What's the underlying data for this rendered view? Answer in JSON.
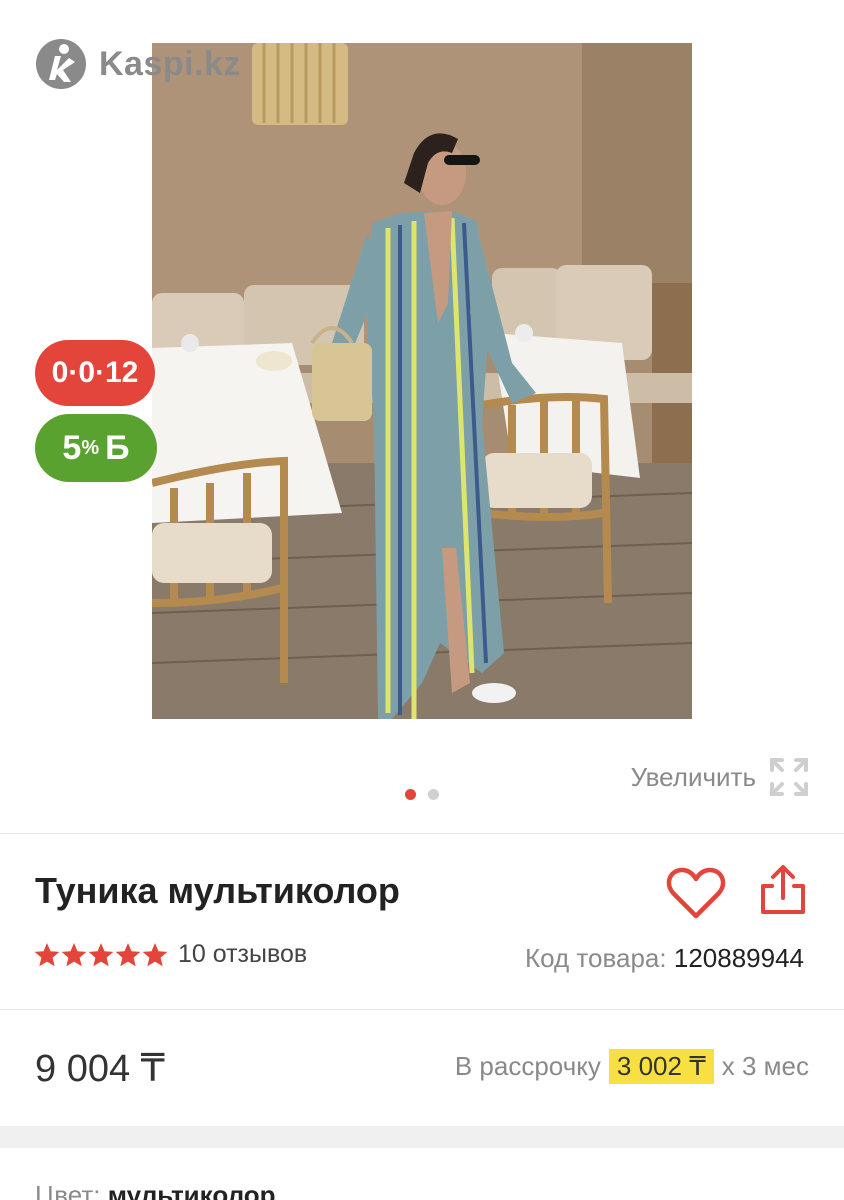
{
  "brand": {
    "name": "Kaspi.kz",
    "logo_icon": "kaspi-logo-icon"
  },
  "badges": {
    "installment": "0·0·12",
    "bonus_value": "5",
    "bonus_suffix": "%",
    "bonus_currency": "Б",
    "installment_color": "#e4453a",
    "bonus_color": "#5aa22f"
  },
  "gallery": {
    "zoom_label": "Увеличить",
    "photo_count": 2,
    "active_photo": 1
  },
  "product": {
    "title": "Туника мультиколор",
    "rating": 5,
    "reviews_label": "10 отзывов",
    "code_label": "Код товара:",
    "code_value": "120889944"
  },
  "pricing": {
    "price": "9 004 ₸",
    "installment_prefix": "В рассрочку",
    "installment_amount": "3 002 ₸",
    "installment_suffix": "x 3 мес",
    "highlight_color": "#f9e042"
  },
  "options": {
    "color_label": "Цвет:",
    "color_value": "мультиколор"
  },
  "colors": {
    "accent": "#e4453a",
    "muted_text": "#8a8a8a"
  }
}
